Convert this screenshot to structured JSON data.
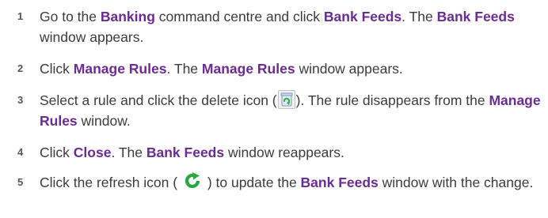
{
  "steps": [
    {
      "num": "1",
      "parts": [
        "Go to the ",
        "Banking",
        " command centre and click ",
        "Bank Feeds",
        ". The ",
        "Bank Feeds",
        " window appears."
      ]
    },
    {
      "num": "2",
      "parts": [
        "Click ",
        "Manage Rules",
        ". The ",
        "Manage Rules",
        " window appears."
      ]
    },
    {
      "num": "3",
      "parts": [
        "Select a rule and click the delete icon (",
        "). The rule disappears from the ",
        "Manage Rules",
        " window."
      ],
      "icon": "delete-icon"
    },
    {
      "num": "4",
      "parts": [
        "Click ",
        "Close",
        ". The ",
        "Bank Feeds",
        " window reappears."
      ]
    },
    {
      "num": "5",
      "parts": [
        "Click the refresh icon ( ",
        " ) to update the ",
        "Bank Feeds",
        " window with the change."
      ],
      "icon": "refresh-icon"
    }
  ],
  "colors": {
    "highlight": "#6b2c91",
    "text": "#3c3c3c",
    "refresh_icon": "#27a840"
  }
}
